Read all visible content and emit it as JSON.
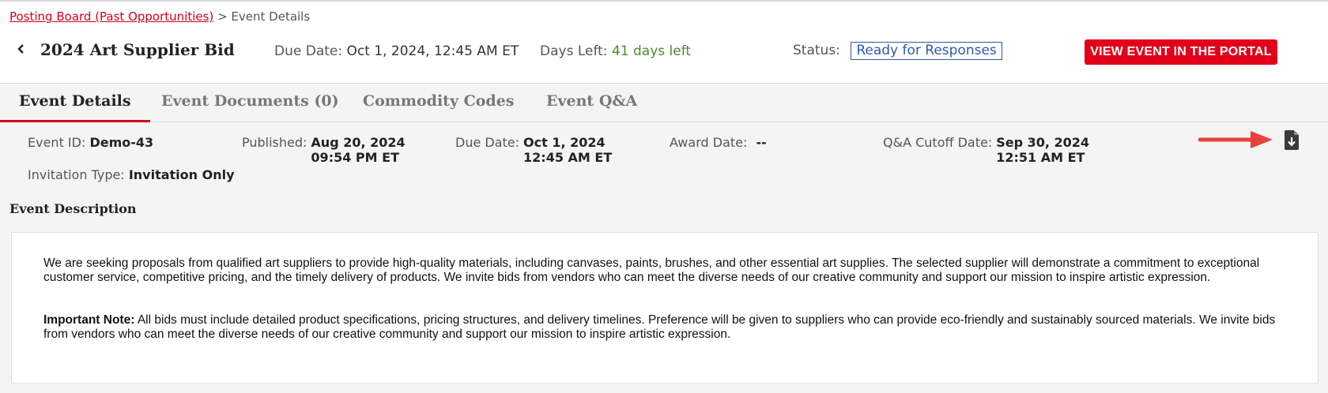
{
  "breadcrumb": {
    "link_label": "Posting Board (Past Opportunities)",
    "separator": ">",
    "current": "Event Details"
  },
  "event": {
    "title": "2024 Art Supplier Bid",
    "due_date_label": "Due Date:",
    "due_date_value": "Oct 1, 2024, 12:45 AM ET",
    "days_left_label": "Days Left:",
    "days_left_value": "41 days left",
    "status_label": "Status:",
    "status_value": "Ready for Responses",
    "portal_button_label": "VIEW EVENT IN THE PORTAL"
  },
  "tabs": [
    {
      "label": "Event Details",
      "active": true
    },
    {
      "label": "Event Documents (0)",
      "active": false
    },
    {
      "label": "Commodity Codes",
      "active": false
    },
    {
      "label": "Event Q&A",
      "active": false
    }
  ],
  "details": {
    "event_id_label": "Event ID:",
    "event_id_value": "Demo-43",
    "published_label": "Published:",
    "published_date": "Aug 20, 2024",
    "published_time": "09:54 PM ET",
    "due_label": "Due Date:",
    "due_date": "Oct 1, 2024",
    "due_time": "12:45 AM ET",
    "award_label": "Award Date:",
    "award_value": "--",
    "qa_cutoff_label": "Q&A Cutoff Date:",
    "qa_cutoff_date": "Sep 30, 2024",
    "qa_cutoff_time": "12:51 AM ET",
    "invitation_label": "Invitation Type:",
    "invitation_value": "Invitation Only"
  },
  "description": {
    "heading": "Event Description",
    "paragraph1": "We are seeking proposals from qualified art suppliers to provide high-quality materials, including canvases, paints, brushes, and other essential art supplies. The selected supplier will demonstrate a commitment to exceptional customer service, competitive pricing, and the timely delivery of products. We invite bids from vendors who can meet the diverse needs of our creative community and support our mission to inspire artistic expression.",
    "note_label": "Important Note:",
    "note_text": "All bids must include detailed product specifications, pricing structures, and delivery timelines. Preference will be given to suppliers who can provide eco-friendly and sustainably sourced materials. We invite bids from vendors who can meet the diverse needs of our creative community and support our mission to inspire artistic expression."
  },
  "icons": {
    "back": "chevron-left-icon",
    "download": "file-download-icon",
    "annotation": "red-arrow-icon"
  },
  "colors": {
    "brand_red": "#e2001a",
    "link_red": "#d0021b",
    "status_blue": "#2f5aa8",
    "days_green": "#4a8c2a"
  }
}
